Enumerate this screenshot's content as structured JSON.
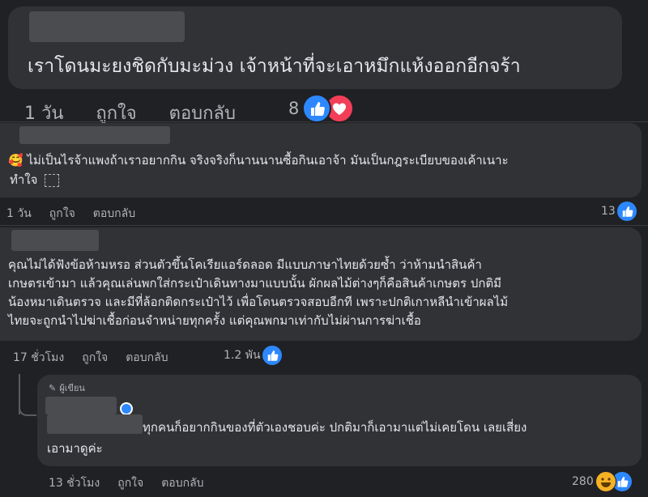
{
  "comments": [
    {
      "text": "เราโดนมะยงชิดกับมะม่วง เจ้าหน้าที่จะเอาหมึกแห้งออกอีกจร้า",
      "time": "1 วัน",
      "like": "ถูกใจ",
      "reply": "ตอบกลับ",
      "reaction_count": "8",
      "reactions": [
        "like-icon",
        "love-icon"
      ]
    },
    {
      "emoji": "🥰",
      "text_line1": "ไม่เป็นไรจ้าแพงถ้าเราอยากกิน จริงจริงก็นานนานซื้อกินเอาจ้า มันเป็นกฎระเบียบของเค้าเนาะ",
      "text_line2": "ทำใจ",
      "time": "1 วัน",
      "like": "ถูกใจ",
      "reply": "ตอบกลับ",
      "reaction_count": "13",
      "reactions": [
        "like-icon"
      ]
    },
    {
      "lines": [
        "คุณไม่ได้ฟังข้อห้ามหรอ ส่วนตัวขึ้นโคเรียแอร์ดลอด มีแบบภาษาไทยด้วยซ้ำ ว่าห้ามนำสินค้า",
        "เกษตรเข้ามา แล้วคุณเล่นพกใส่กระเป๋าเดินทางมาแบบนั้น ผักผลไม้ต่างๆก็คือสินค้าเกษตร ปกติมี",
        "น้องหมาเดินตรวจ และมีที่ล้อกติดกระเป๋าไว้ เพื่อโดนตรวจสอบอีกที เพราะปกติเกาหลีนำเข้าผลไม้",
        "ไทยจะถูกนำไปฆ่าเชื้อก่อนจำหน่ายทุกครั้ง แต่คุณพกมาเท่ากับไม่ผ่านการฆ่าเชื้อ"
      ],
      "time": "17 ชั่วโมง",
      "like": "ถูกใจ",
      "reply": "ตอบกลับ",
      "reaction_count": "1.2 พัน",
      "reactions": [
        "like-icon"
      ]
    },
    {
      "badge": "ผู้เขียน",
      "lines": [
        "ทุกคนก็อยากกินของที่ตัวเองชอบค่ะ ปกติมาก็เอามาแต่ไม่เคยโดน เลยเสี่ยง",
        "เอามาดูค่ะ"
      ],
      "time": "13 ชั่วโมง",
      "like": "ถูกใจ",
      "reply": "ตอบกลับ",
      "reaction_count": "280",
      "reactions": [
        "haha-icon",
        "like-icon"
      ]
    }
  ],
  "colors": {
    "background": "#202124",
    "bubble": "#303236",
    "text": "#e4e6eb",
    "muted": "#b0b3b8",
    "like_blue": "#2d88ff",
    "love_red": "#f33e58"
  }
}
